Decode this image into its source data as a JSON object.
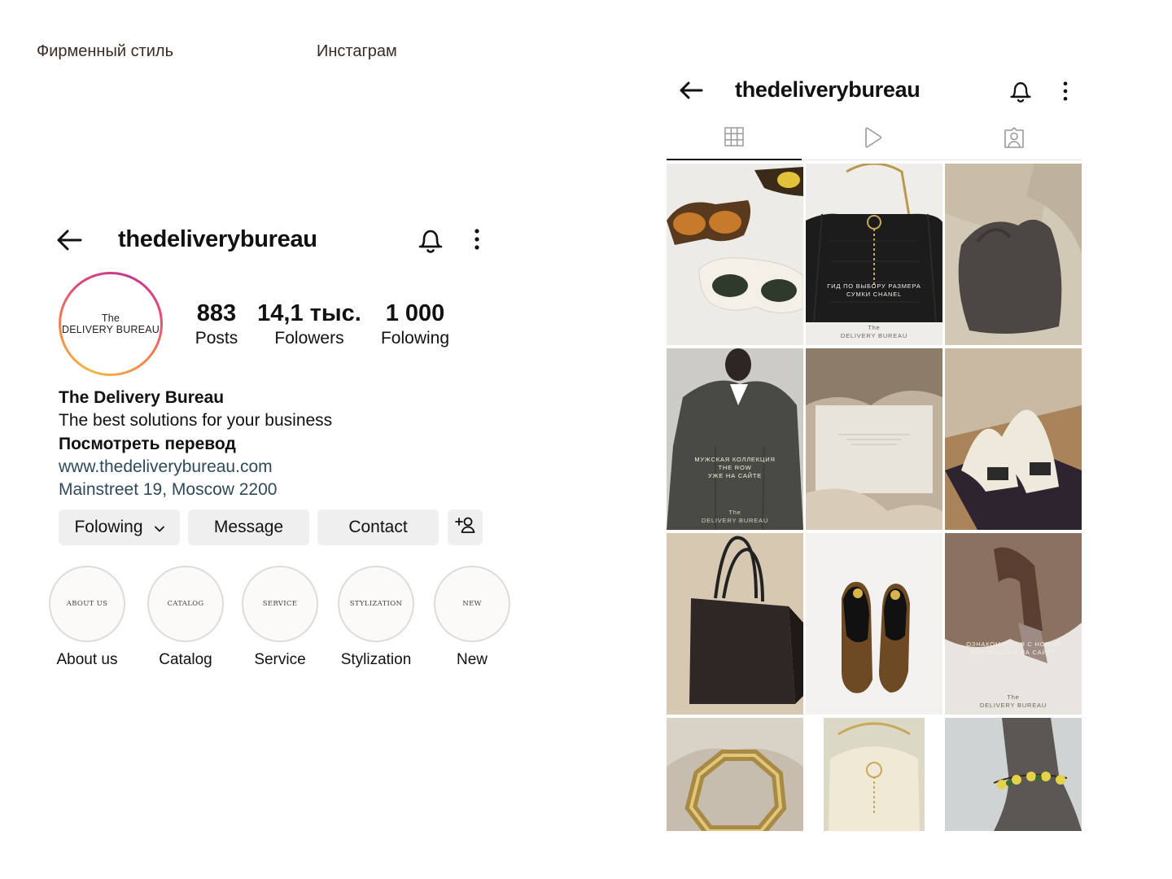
{
  "labels": {
    "left": "Фирменный стиль",
    "right": "Инстаграм"
  },
  "profile": {
    "username": "thedeliverybureau",
    "avatar_line1": "The",
    "avatar_line2": "DELIVERY BUREAU",
    "stats": {
      "posts_num": "883",
      "posts_label": "Posts",
      "followers_num": "14,1 тыс.",
      "followers_label": "Folowers",
      "following_num": "1 000",
      "following_label": "Folowing"
    },
    "bio": {
      "name": "The Delivery Bureau",
      "tagline": "The best solutions for your business",
      "translate": "Посмотреть перевод",
      "website": "www.thedeliverybureau.com",
      "address": "Mainstreet 19, Moscow 2200"
    },
    "buttons": {
      "following": "Folowing",
      "message": "Message",
      "contact": "Contact"
    },
    "highlights": [
      {
        "cover": "ABOUT US",
        "label": "About us"
      },
      {
        "cover": "CATALOG",
        "label": "Catalog"
      },
      {
        "cover": "SERVICE",
        "label": "Service"
      },
      {
        "cover": "STYLIZATION",
        "label": "Stylization"
      },
      {
        "cover": "NEW",
        "label": "New"
      }
    ]
  },
  "feed": {
    "username": "thedeliverybureau",
    "captions": {
      "chanel_line1": "ГИД ПО ВЫБОРУ РАЗМЕРА",
      "chanel_line2": "СУМКИ CHANEL",
      "brand_the": "The",
      "brand_name": "DELIVERY BUREAU",
      "row_line1": "МУЖСКАЯ КОЛЛЕКЦИЯ",
      "row_line2": "THE ROW",
      "row_line3": "УЖЕ НА САЙТЕ",
      "new_line1": "ОЗНАКОМИТЬСЯ С НОВОЙ",
      "new_line2": "КОЛЛЕКЦИЕЙ НА САЙТЕ"
    }
  },
  "colors": {
    "ring_start": "#f2b845",
    "ring_end": "#c1378f",
    "button_bg": "#efefef",
    "link": "#2e4a5a"
  }
}
